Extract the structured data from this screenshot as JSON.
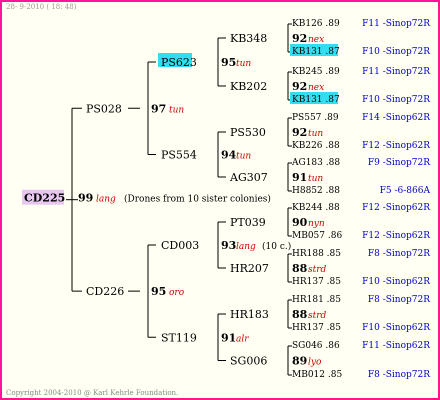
{
  "header": "28- 9-2010 ( 18: 48)",
  "copyright": "Copyright 2004-2010 @ Karl Kehrle Foundation.",
  "root": {
    "name": "CD225",
    "num": "99",
    "tag": "lang",
    "note": "(Drones from 10 sister colonies)"
  },
  "gen1": [
    {
      "name": "PS028",
      "num": "97",
      "tag": "tun"
    },
    {
      "name": "CD226",
      "num": "95",
      "tag": "oro"
    }
  ],
  "gen2": [
    {
      "name": "PS623",
      "num": "95",
      "tag": "tun",
      "highlight": true
    },
    {
      "name": "PS554",
      "num": "94",
      "tag": "tun"
    },
    {
      "name": "CD003",
      "num": "93",
      "tag": "lang",
      "note": "(10 c.)"
    },
    {
      "name": "ST119",
      "num": "91",
      "tag": "alr"
    }
  ],
  "gen3": [
    {
      "name": "KB348",
      "num": "92",
      "tag": "nex"
    },
    {
      "name": "KB202",
      "num": "92",
      "tag": "nex"
    },
    {
      "name": "PS530",
      "num": "92",
      "tag": "tun"
    },
    {
      "name": "AG307",
      "num": "91",
      "tag": "tun"
    },
    {
      "name": "PT039",
      "num": "90",
      "tag": "nyn"
    },
    {
      "name": "HR207",
      "num": "88",
      "tag": "strd"
    },
    {
      "name": "HR183",
      "num": "88",
      "tag": "strd"
    },
    {
      "name": "SG006",
      "num": "89",
      "tag": "lyo"
    }
  ],
  "gen4": [
    {
      "code": "KB126 .89",
      "right": "F11 -Sinop72R"
    },
    {
      "code": "KB131 .87",
      "right": "F10 -Sinop72R",
      "highlight": true
    },
    {
      "code": "KB245 .89",
      "right": "F11 -Sinop72R"
    },
    {
      "code": "KB131 .87",
      "right": "F10 -Sinop72R",
      "highlight": true
    },
    {
      "code": "PS557 .89",
      "right": "F14 -Sinop62R"
    },
    {
      "code": "KB226 .88",
      "right": "F12 -Sinop62R"
    },
    {
      "code": "AG183 .88",
      "right": "F9 -Sinop72R"
    },
    {
      "code": "H8852 .88",
      "right": "F5 -6-866A"
    },
    {
      "code": "KB244 .88",
      "right": "F12 -Sinop62R"
    },
    {
      "code": "MB057 .86",
      "right": "F12 -Sinop62R"
    },
    {
      "code": "HR188 .85",
      "right": "F8 -Sinop72R"
    },
    {
      "code": "HR137 .85",
      "right": "F10 -Sinop62R"
    },
    {
      "code": "HR181 .85",
      "right": "F8 -Sinop72R"
    },
    {
      "code": "HR137 .85",
      "right": "F10 -Sinop62R"
    },
    {
      "code": "SG046 .86",
      "right": "F11 -Sinop62R"
    },
    {
      "code": "MB012 .85",
      "right": "F8 -Sinop72R"
    }
  ],
  "colors": {
    "border": "#ff1493",
    "highlight": "#33ddee",
    "root_bg": "#e8c8f0",
    "tag": "#cc0000",
    "right": "#0000cc"
  }
}
